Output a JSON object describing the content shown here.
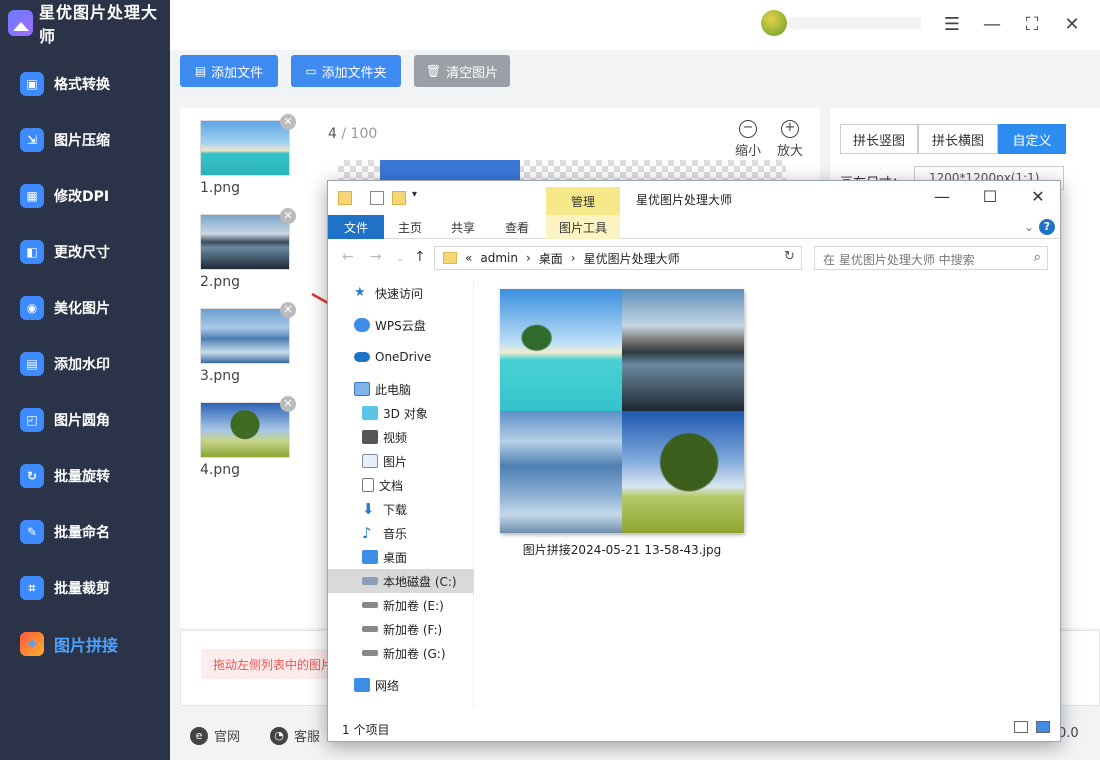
{
  "app": {
    "title": "星优图片处理大师"
  },
  "sidebar": {
    "items": [
      {
        "label": "格式转换",
        "icon": "format-icon"
      },
      {
        "label": "图片压缩",
        "icon": "compress-icon"
      },
      {
        "label": "修改DPI",
        "icon": "dpi-icon"
      },
      {
        "label": "更改尺寸",
        "icon": "resize-icon"
      },
      {
        "label": "美化图片",
        "icon": "beautify-icon"
      },
      {
        "label": "添加水印",
        "icon": "watermark-icon"
      },
      {
        "label": "图片圆角",
        "icon": "rounded-corner-icon"
      },
      {
        "label": "批量旋转",
        "icon": "rotate-icon"
      },
      {
        "label": "批量命名",
        "icon": "rename-icon"
      },
      {
        "label": "批量裁剪",
        "icon": "crop-icon"
      },
      {
        "label": "图片拼接",
        "icon": "stitch-icon",
        "active": true
      }
    ]
  },
  "toolbar": {
    "add_file": "添加文件",
    "add_folder": "添加文件夹",
    "clear": "清空图片",
    "accent": "#3d8bf0"
  },
  "files": [
    {
      "name": "1.png"
    },
    {
      "name": "2.png"
    },
    {
      "name": "3.png"
    },
    {
      "name": "4.png"
    }
  ],
  "preview": {
    "count": "4",
    "total": "100",
    "zoom_out": "缩小",
    "zoom_in": "放大"
  },
  "settings": {
    "tabs": [
      "拼长竖图",
      "拼长横图",
      "自定义"
    ],
    "selected_tab": "自定义",
    "canvas_label": "画布尺寸：",
    "canvas_value": "1200*1200px(1:1)"
  },
  "hint": "拖动左侧列表中的图片",
  "footer": {
    "website": "官网",
    "support": "客服",
    "version": "0.0"
  },
  "explorer": {
    "title": "星优图片处理大师",
    "manage_tab": "管理",
    "ribbon_tabs": [
      "文件",
      "主页",
      "共享",
      "查看",
      "图片工具"
    ],
    "path": [
      "admin",
      "桌面",
      "星优图片处理大师"
    ],
    "search_placeholder": "在 星优图片处理大师 中搜索",
    "nav": [
      {
        "label": "快速访问",
        "icon": "star-icon"
      },
      {
        "label": "WPS云盘",
        "icon": "cloud-icon"
      },
      {
        "label": "OneDrive",
        "icon": "onedrive-icon"
      },
      {
        "label": "此电脑",
        "icon": "computer-icon"
      },
      {
        "label": "3D 对象",
        "icon": "3d-object-icon"
      },
      {
        "label": "视频",
        "icon": "video-icon"
      },
      {
        "label": "图片",
        "icon": "pictures-icon"
      },
      {
        "label": "文档",
        "icon": "document-icon"
      },
      {
        "label": "下载",
        "icon": "download-icon"
      },
      {
        "label": "音乐",
        "icon": "music-icon"
      },
      {
        "label": "桌面",
        "icon": "desktop-icon"
      },
      {
        "label": "本地磁盘 (C:)",
        "icon": "drive-icon",
        "selected": true
      },
      {
        "label": "新加卷 (E:)",
        "icon": "drive-icon"
      },
      {
        "label": "新加卷 (F:)",
        "icon": "drive-icon"
      },
      {
        "label": "新加卷 (G:)",
        "icon": "drive-icon"
      },
      {
        "label": "网络",
        "icon": "network-icon"
      }
    ],
    "file": {
      "name": "图片拼接2024-05-21 13-58-43.jpg"
    },
    "status": "1 个项目"
  }
}
